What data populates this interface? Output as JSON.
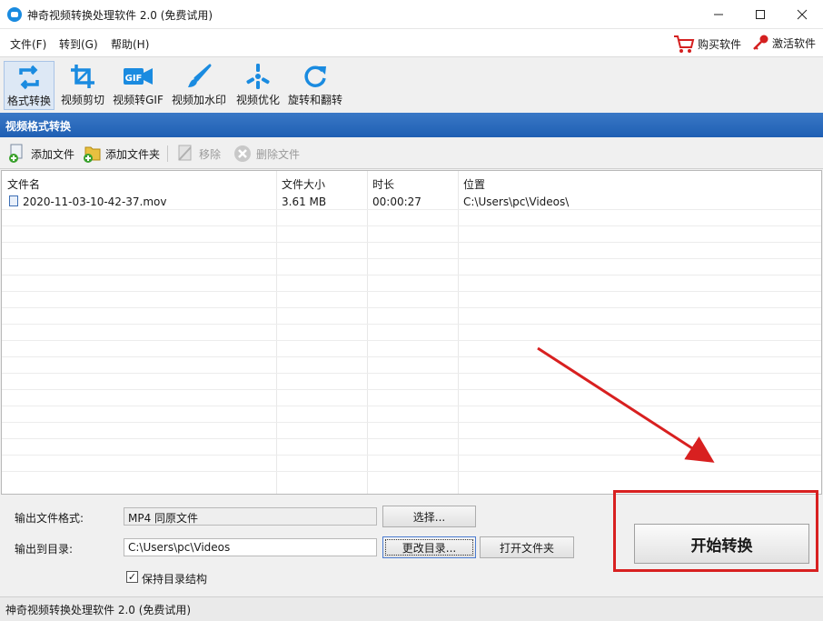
{
  "window": {
    "title": "神奇视频转换处理软件 2.0 (免费试用)"
  },
  "menu": {
    "items": [
      {
        "label": "文件(F)"
      },
      {
        "label": "转到(G)"
      },
      {
        "label": "帮助(H)"
      }
    ],
    "buy_label": "购买软件",
    "activate_label": "激活软件"
  },
  "toolbar": {
    "tools": [
      {
        "label": "格式转换",
        "icon": "convert-icon"
      },
      {
        "label": "视频剪切",
        "icon": "crop-icon"
      },
      {
        "label": "视频转GIF",
        "icon": "gif-icon"
      },
      {
        "label": "视频加水印",
        "icon": "brush-icon"
      },
      {
        "label": "视频优化",
        "icon": "optimize-icon"
      },
      {
        "label": "旋转和翻转",
        "icon": "rotate-icon"
      }
    ],
    "gif_text": "GIF"
  },
  "section_title": "视频格式转换",
  "file_actions": {
    "add_file": "添加文件",
    "add_folder": "添加文件夹",
    "remove": "移除",
    "delete_file": "删除文件"
  },
  "table": {
    "columns": [
      "文件名",
      "文件大小",
      "时长",
      "位置"
    ],
    "rows": [
      {
        "name": "2020-11-03-10-42-37.mov",
        "size": "3.61 MB",
        "duration": "00:00:27",
        "location": "C:\\Users\\pc\\Videos\\"
      }
    ]
  },
  "output": {
    "format_label": "输出文件格式:",
    "format_value": "MP4 同原文件",
    "select_button": "选择...",
    "dir_label": "输出到目录:",
    "dir_value": "C:\\Users\\pc\\Videos",
    "change_dir_button": "更改目录...",
    "open_folder_button": "打开文件夹",
    "keep_structure_label": "保持目录结构",
    "keep_structure_checked": true
  },
  "start_button": "开始转换",
  "status_text": "神奇视频转换处理软件 2.0 (免费试用)",
  "colors": {
    "accent": "#1f5fb3",
    "tool_icon": "#1a8be0",
    "highlight": "#d82020"
  }
}
